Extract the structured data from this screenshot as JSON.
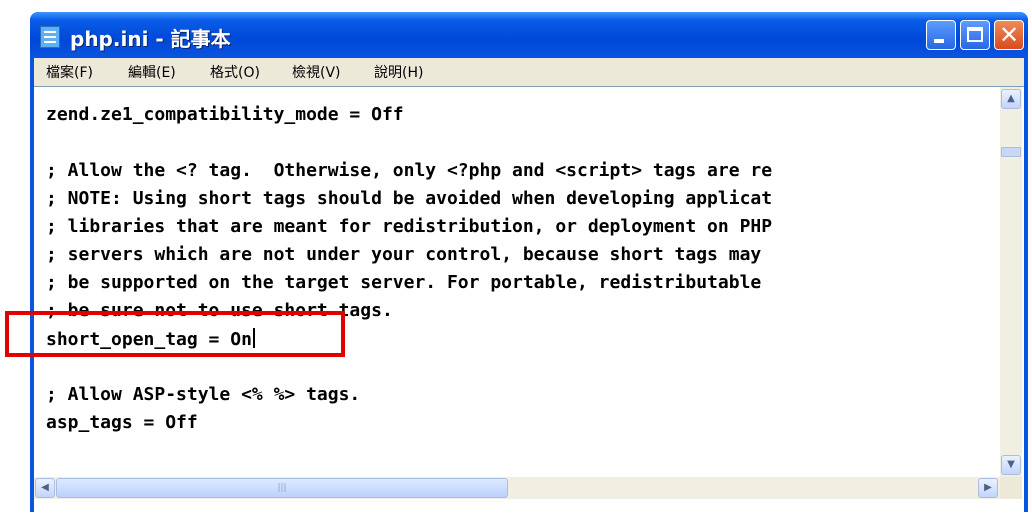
{
  "window": {
    "title": "php.ini - 記事本",
    "icon": "notepad-icon",
    "buttons": {
      "minimize": "minimize-icon",
      "maximize": "maximize-icon",
      "close": "close-icon"
    }
  },
  "menu": {
    "items": [
      {
        "label": "檔案(F)"
      },
      {
        "label": "編輯(E)"
      },
      {
        "label": "格式(O)"
      },
      {
        "label": "檢視(V)"
      },
      {
        "label": "說明(H)"
      }
    ]
  },
  "editor": {
    "lines": [
      "zend.ze1_compatibility_mode = Off",
      "",
      "; Allow the <? tag.  Otherwise, only <?php and <script> tags are re",
      "; NOTE: Using short tags should be avoided when developing applicat",
      "; libraries that are meant for redistribution, or deployment on PHP",
      "; servers which are not under your control, because short tags may",
      "; be supported on the target server. For portable, redistributable",
      "; be sure not to use short tags.",
      "short_open_tag = On",
      "",
      "; Allow ASP-style <% %> tags.",
      "asp_tags = Off"
    ]
  },
  "annotation": {
    "color": "#e00000"
  },
  "colors": {
    "titlebar": "#0a55e0",
    "menubar": "#ece9d8",
    "close_button": "#d94a1c"
  }
}
